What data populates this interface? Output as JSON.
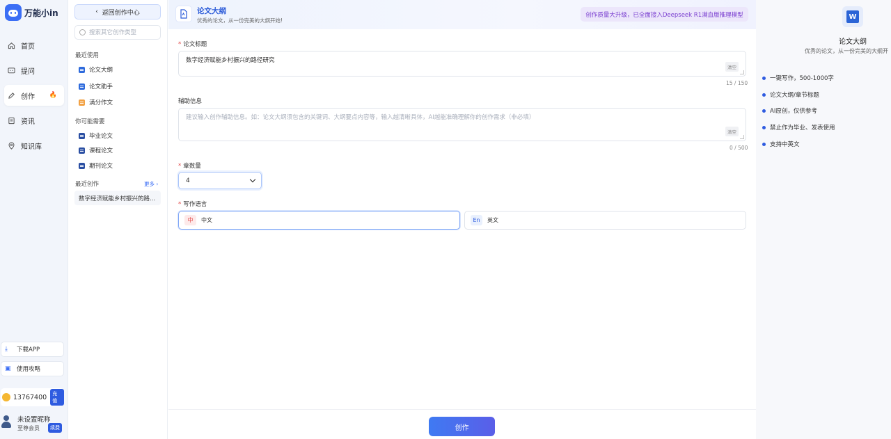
{
  "app": {
    "name": "万能小in"
  },
  "nav": {
    "items": [
      {
        "label": "首页",
        "icon": "home-icon"
      },
      {
        "label": "提问",
        "icon": "chat-icon"
      },
      {
        "label": "创作",
        "icon": "pen-icon",
        "active": true
      },
      {
        "label": "资讯",
        "icon": "news-icon"
      },
      {
        "label": "知识库",
        "icon": "location-icon"
      }
    ],
    "download_app": "下载APP",
    "guide": "使用攻略",
    "credits": "13767400",
    "recharge": "充值",
    "user_name": "未设置昵称",
    "user_level": "至尊会员",
    "renew": "续费"
  },
  "sidebar": {
    "back": "返回创作中心",
    "search_placeholder": "搜索其它创作类型",
    "recent_used_title": "最近使用",
    "recent_used": [
      "论文大纲",
      "论文助手",
      "满分作文"
    ],
    "maybe_need_title": "你可能需要",
    "maybe_need": [
      "毕业论文",
      "课程论文",
      "期刊论文"
    ],
    "recent_creation_title": "最近创作",
    "more": "更多",
    "recent_creation": [
      "数字经济赋能乡村振兴的路..."
    ]
  },
  "header": {
    "title": "论文大纲",
    "subtitle": "优秀的论文，从一份完美的大纲开始!",
    "banner": "创作质量大升级，已全面接入Deepseek R1满血版推理模型"
  },
  "form": {
    "title_label": "论文标题",
    "title_value": "数字经济赋能乡村振兴的路径研究",
    "title_count": "15 / 150",
    "clear": "清空",
    "aux_label": "辅助信息",
    "aux_placeholder": "建议输入创作辅助信息。如：论文大纲须包含的关键词、大纲要点内容等，输入越清晰具体，AI越能准确理解你的创作需求（非必填）",
    "aux_count": "0 / 500",
    "chapters_label": "章数量",
    "chapters_value": "4",
    "language_label": "写作语言",
    "lang_zh_tag": "中",
    "lang_zh": "中文",
    "lang_en_tag": "En",
    "lang_en": "英文",
    "create": "创作"
  },
  "right_panel": {
    "title": "论文大纲",
    "subtitle": "优秀的论文，从一份完美的大纲开",
    "features": [
      "一键写作，500-1000字",
      "论文大纲/章节标题",
      "AI原创，仅供参考",
      "禁止作为毕业、发表使用",
      "支持中英文"
    ]
  },
  "colors": {
    "accent": "#2e5be0",
    "banner_text": "#7a3ed0",
    "required": "#e24a4a"
  }
}
